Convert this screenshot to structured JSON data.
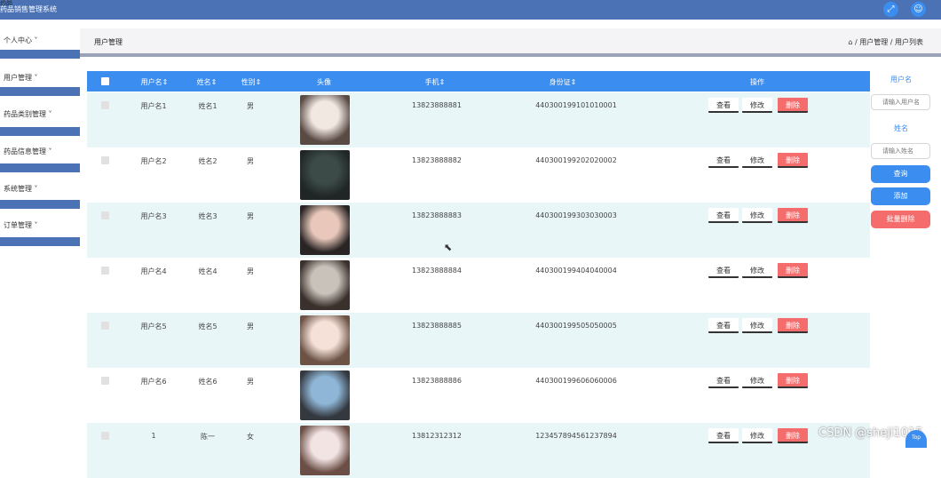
{
  "app": {
    "title": "药品销售管理系统",
    "corner_text": "药品"
  },
  "header": {
    "fullscreen_icon": "fullscreen-icon",
    "user_icon": "user-icon"
  },
  "sidebar": {
    "items": [
      {
        "label": "个人中心 ˅"
      },
      {
        "label": "用户管理 ˅"
      },
      {
        "label": "药品类别管理 ˅"
      },
      {
        "label": "药品信息管理 ˅"
      },
      {
        "label": "系统管理 ˅"
      },
      {
        "label": "订单管理 ˅"
      }
    ]
  },
  "page": {
    "title": "用户管理",
    "breadcrumb": "/ 用户管理 / 用户列表"
  },
  "table": {
    "columns": [
      "用户名⇕",
      "姓名⇕",
      "性别⇕",
      "头像",
      "手机⇕",
      "身份证⇕",
      "操作"
    ],
    "rows": [
      {
        "username": "用户名1",
        "name": "姓名1",
        "gender": "男",
        "phone": "13823888881",
        "idcard": "440300199101010001"
      },
      {
        "username": "用户名2",
        "name": "姓名2",
        "gender": "男",
        "phone": "13823888882",
        "idcard": "440300199202020002"
      },
      {
        "username": "用户名3",
        "name": "姓名3",
        "gender": "男",
        "phone": "13823888883",
        "idcard": "440300199303030003"
      },
      {
        "username": "用户名4",
        "name": "姓名4",
        "gender": "男",
        "phone": "13823888884",
        "idcard": "440300199404040004"
      },
      {
        "username": "用户名5",
        "name": "姓名5",
        "gender": "男",
        "phone": "13823888885",
        "idcard": "440300199505050005"
      },
      {
        "username": "用户名6",
        "name": "姓名6",
        "gender": "男",
        "phone": "13823888886",
        "idcard": "440300199606060006"
      },
      {
        "username": "1",
        "name": "陈一",
        "gender": "女",
        "phone": "13812312312",
        "idcard": "123457894561237894"
      }
    ],
    "actions": {
      "view": "查看",
      "edit": "修改",
      "delete": "删除"
    }
  },
  "search": {
    "username_label": "用户名",
    "username_placeholder": "请输入用户名",
    "name_label": "姓名",
    "name_placeholder": "请输入姓名",
    "query_button": "查询",
    "add_button": "添加",
    "batch_delete_button": "批量删除"
  },
  "footer": {
    "watermark": "CSDN @sheji1015",
    "top_button": "Top"
  },
  "colors": {
    "primary": "#3b8ef0",
    "danger": "#f56c6c",
    "topbar": "#4a72b5",
    "row_alt": "#e8f6f8"
  }
}
